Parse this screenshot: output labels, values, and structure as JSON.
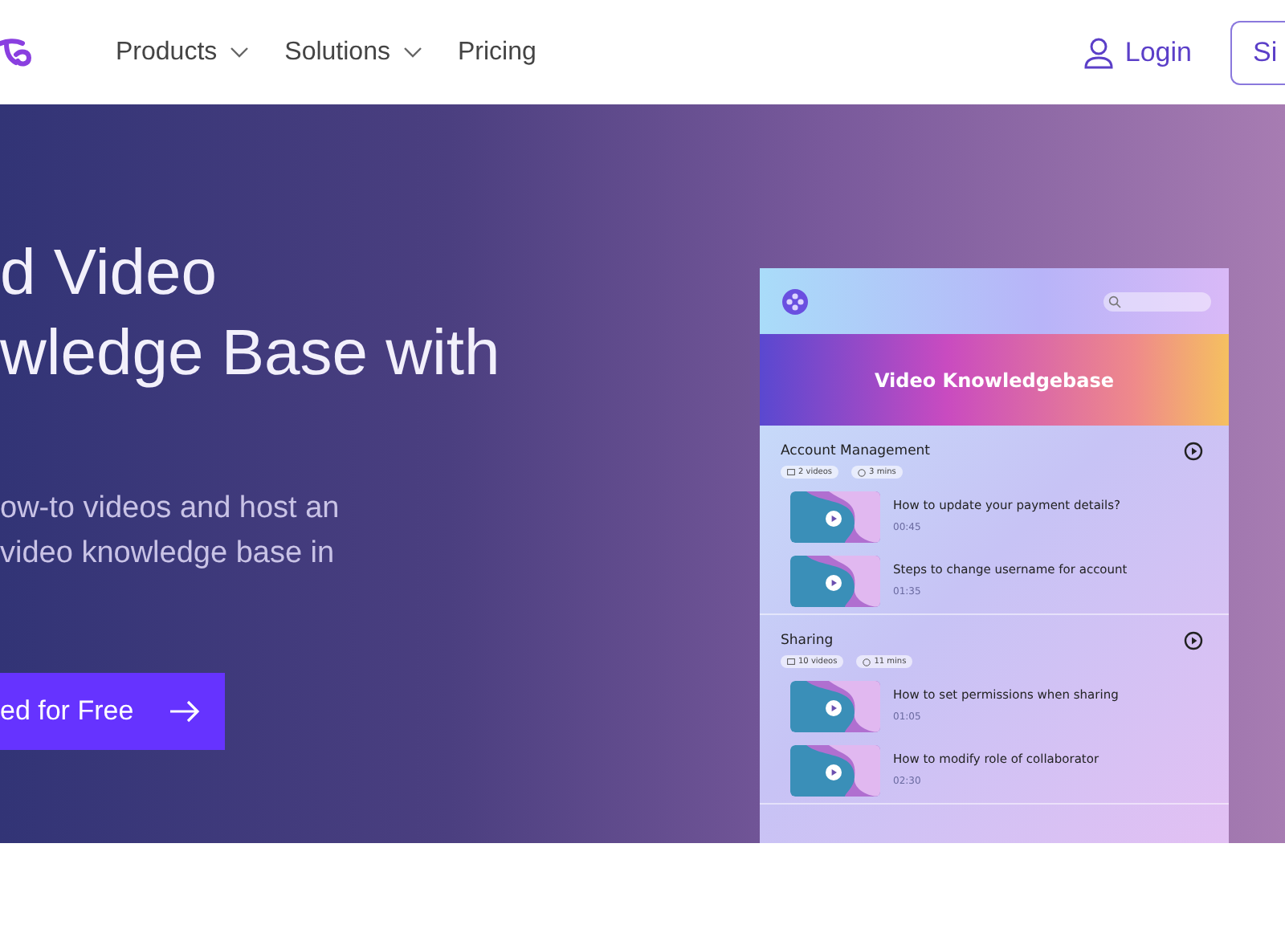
{
  "nav": {
    "items": [
      {
        "label": "Products",
        "dropdown": true
      },
      {
        "label": "Solutions",
        "dropdown": true
      },
      {
        "label": "Pricing",
        "dropdown": false
      }
    ],
    "login": "Login",
    "signup": "Si"
  },
  "hero": {
    "title_lines": [
      "d Video",
      "wledge Base with"
    ],
    "subtitle_lines": [
      "ow-to videos and host an",
      "video knowledge base in"
    ],
    "cta": "ed for Free"
  },
  "preview": {
    "banner": "Video Knowledgebase",
    "sections": [
      {
        "title": "Account Management",
        "videos": "2 videos",
        "duration": "3 mins",
        "items": [
          {
            "title": "How to update your payment details?",
            "time": "00:45"
          },
          {
            "title": "Steps to change username for account",
            "time": "01:35"
          }
        ]
      },
      {
        "title": "Sharing",
        "videos": "10 videos",
        "duration": "11 mins",
        "items": [
          {
            "title": "How to set permissions when sharing",
            "time": "01:05"
          },
          {
            "title": "How to modify role of collaborator",
            "time": "02:30"
          }
        ]
      }
    ]
  }
}
